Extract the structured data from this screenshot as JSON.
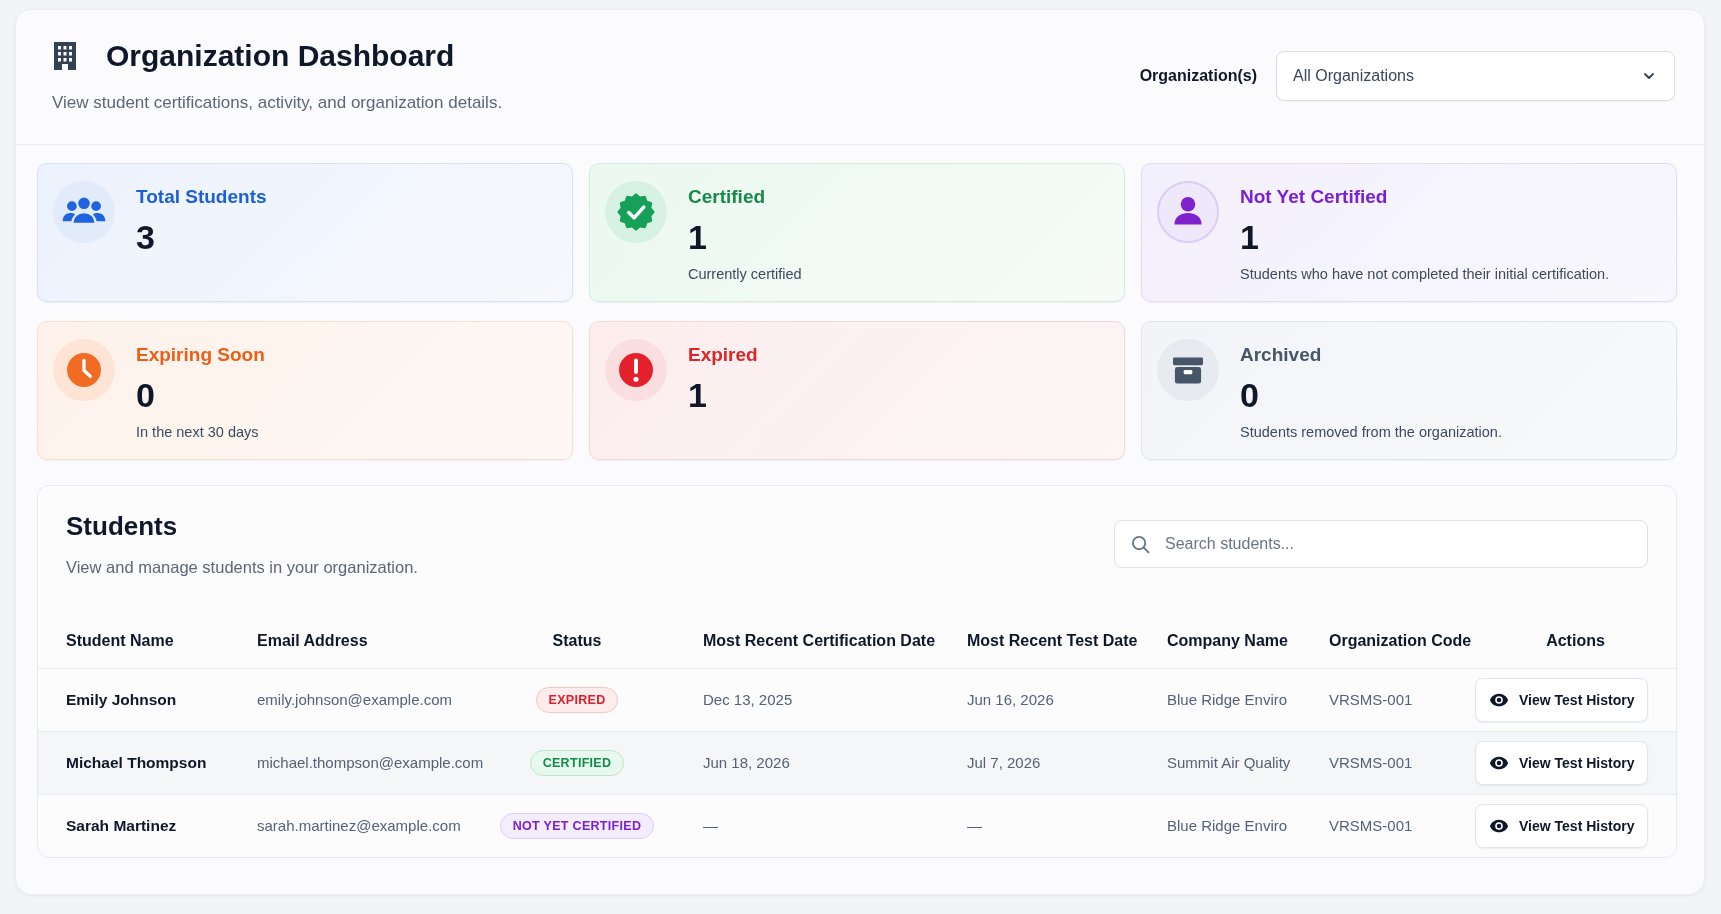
{
  "header": {
    "title": "Organization Dashboard",
    "subtitle": "View student certifications, activity, and organization details.",
    "filter": {
      "label": "Organization(s)",
      "value": "All Organizations"
    }
  },
  "stats": [
    {
      "kind": "total",
      "title": "Total Students",
      "value": "3"
    },
    {
      "kind": "certified",
      "title": "Certified",
      "value": "1",
      "note": "Currently certified"
    },
    {
      "kind": "not_certified",
      "title": "Not Yet Certified",
      "value": "1",
      "note": "Students who have not completed their initial certification."
    },
    {
      "kind": "expiring",
      "title": "Expiring Soon",
      "value": "0",
      "note": "In the next 30 days"
    },
    {
      "kind": "expired",
      "title": "Expired",
      "value": "1"
    },
    {
      "kind": "archived",
      "title": "Archived",
      "value": "0",
      "note": "Students removed from the organization."
    }
  ],
  "students": {
    "title": "Students",
    "subtitle": "View and manage students in your organization.",
    "search": {
      "placeholder": "Search students..."
    },
    "table": {
      "columns": [
        "Student Name",
        "Email Address",
        "Status",
        "Most Recent Certification Date",
        "Most Recent Test Date",
        "Company Name",
        "Organization Code",
        "Actions"
      ],
      "rows": [
        {
          "name": "Emily Johnson",
          "email": "emily.johnson@example.com",
          "status": {
            "label": "EXPIRED",
            "kind": "expired"
          },
          "certification_date": "Dec 13, 2025",
          "test_date": "Jun 16, 2026",
          "company": "Blue Ridge Enviro",
          "organization_code": "VRSMS-001",
          "action": "View Test History"
        },
        {
          "name": "Michael Thompson",
          "email": "michael.thompson@example.com",
          "status": {
            "label": "CERTIFIED",
            "kind": "certified"
          },
          "certification_date": "Jun 18, 2026",
          "test_date": "Jul 7, 2026",
          "company": "Summit Air Quality",
          "organization_code": "VRSMS-001",
          "action": "View Test History"
        },
        {
          "name": "Sarah Martinez",
          "email": "sarah.martinez@example.com",
          "status": {
            "label": "NOT YET CERTIFIED",
            "kind": "not_certified"
          },
          "certification_date": "—",
          "test_date": "—",
          "company": "Blue Ridge Enviro",
          "organization_code": "VRSMS-001",
          "action": "View Test History"
        }
      ]
    }
  }
}
